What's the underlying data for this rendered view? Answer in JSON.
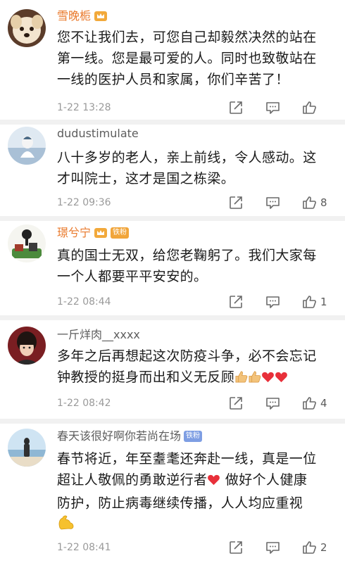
{
  "comments": [
    {
      "username": "雪晚栀",
      "username_style": "orange",
      "badge": "",
      "text_lines": [
        "您不让我们去，可您自己却毅然决然的站在",
        "第一线。您是最可爱的人。同时也致敬站在",
        "一线的医护人员和家属，你们辛苦了！"
      ],
      "time": "1-22 13:28",
      "likes": ""
    },
    {
      "username": "dudustimulate",
      "username_style": "grey",
      "badge": "",
      "text_lines": [
        "八十多岁的老人，亲上前线，令人感动。这",
        "才叫院士，这才是国之栋梁。"
      ],
      "time": "1-22 09:36",
      "likes": "8"
    },
    {
      "username": "璟兮宁",
      "username_style": "orange",
      "badge": "铁粉",
      "text_lines": [
        "真的国士无双，给您老鞠躬了。我们大家每",
        "一个人都要平平安安的。"
      ],
      "time": "1-22 08:44",
      "likes": "1"
    },
    {
      "username": "一斤烊肉__xxxx",
      "username_style": "grey",
      "badge": "",
      "text_lines": [
        "多年之后再想起这次防疫斗争，必不会忘记",
        "钟教授的挺身而出和义无反顾"
      ],
      "time": "1-22 08:42",
      "likes": "4"
    },
    {
      "username": "春天该很好啊你若尚在场",
      "username_style": "grey",
      "badge": "铁粉",
      "text_lines": [
        "春节将近，年至耋耄还奔赴一线，真是一位",
        "超让人敬佩的勇敢逆行者",
        "防护，防止病毒继续传播，人人均应重视"
      ],
      "text_line2_suffix": " 做好个人健康",
      "time": "1-22 08:41",
      "likes": "2"
    }
  ],
  "icons": {
    "share": "share-icon",
    "comment": "comment-icon",
    "like": "thumbs-up-icon",
    "vip": "vip-crown-icon",
    "heart": "red-heart-emoji",
    "thumb_emoji": "thumbs-up-emoji",
    "muscle": "flexed-biceps-emoji"
  },
  "colors": {
    "orange_name": "#e9782a",
    "grey_name": "#5d5d5d",
    "badge_fan": "#7e9ee3",
    "heart": "#e8303a"
  }
}
